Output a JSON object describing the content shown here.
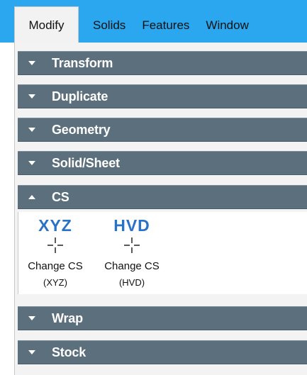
{
  "tabs": [
    {
      "label": "Modify",
      "active": true
    },
    {
      "label": "Solids",
      "active": false
    },
    {
      "label": "Features",
      "active": false
    },
    {
      "label": "Window",
      "active": false
    }
  ],
  "sections": [
    {
      "label": "Transform",
      "expanded": false
    },
    {
      "label": "Duplicate",
      "expanded": false
    },
    {
      "label": "Geometry",
      "expanded": false
    },
    {
      "label": "Solid/Sheet",
      "expanded": false
    },
    {
      "label": "CS",
      "expanded": true
    },
    {
      "label": "Wrap",
      "expanded": false
    },
    {
      "label": "Stock",
      "expanded": false
    }
  ],
  "cs_tools": [
    {
      "big_label": "XYZ",
      "label_line1": "Change CS",
      "label_line2": "(XYZ)",
      "icon": "crosshair-icon"
    },
    {
      "big_label": "HVD",
      "label_line1": "Change CS",
      "label_line2": "(HVD)",
      "icon": "crosshair-icon"
    }
  ],
  "colors": {
    "tab_bar": "#2aa7ee",
    "active_tab": "#f2f2f2",
    "section_header": "#5c6f7d",
    "tool_accent": "#2872c7"
  }
}
